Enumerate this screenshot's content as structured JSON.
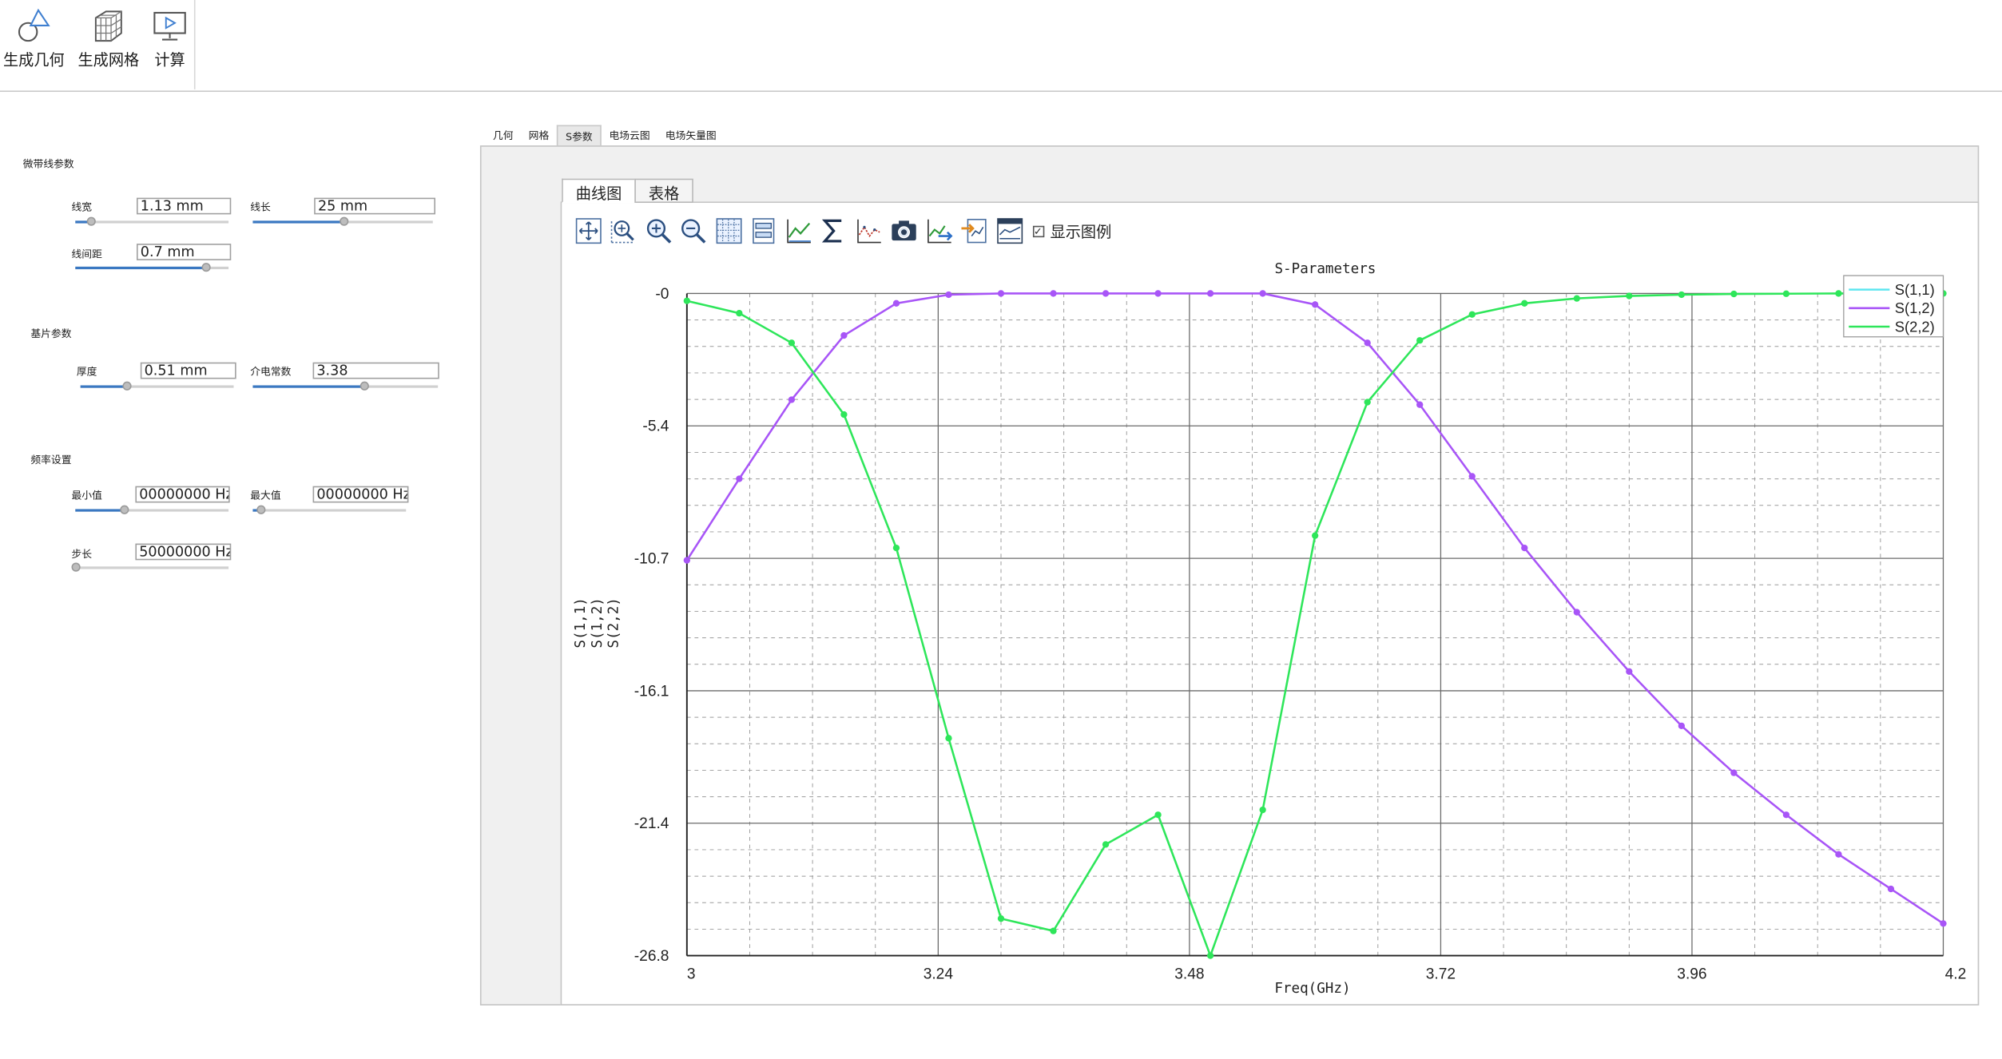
{
  "ribbon": {
    "buttons": [
      {
        "label": "生成几何",
        "icon": "geometry-icon"
      },
      {
        "label": "生成网格",
        "icon": "mesh-icon"
      },
      {
        "label": "计算",
        "icon": "compute-icon"
      }
    ]
  },
  "params": {
    "microstrip": {
      "title": "微带线参数",
      "width": {
        "label": "线宽",
        "value": "1.13 mm",
        "level": 0.1
      },
      "length": {
        "label": "线长",
        "value": "25 mm",
        "level": 0.5
      },
      "spacing": {
        "label": "线间距",
        "value": "0.7 mm",
        "level": 0.85
      }
    },
    "substrate": {
      "title": "基片参数",
      "thickness": {
        "label": "厚度",
        "value": "0.51 mm",
        "level": 0.3
      },
      "permittivity": {
        "label": "介电常数",
        "value": "3.38",
        "level": 0.6
      }
    },
    "frequency": {
      "title": "频率设置",
      "min": {
        "label": "最小值",
        "value": "00000000 Hz",
        "level": 0.32
      },
      "max": {
        "label": "最大值",
        "value": "00000000 Hz",
        "level": 0.05
      },
      "step": {
        "label": "步长",
        "value": "50000000 Hz",
        "level": 0.0
      }
    }
  },
  "tabs": [
    "几何",
    "网格",
    "S参数",
    "电场云图",
    "电场矢量图"
  ],
  "active_tab": 2,
  "subtabs": [
    "曲线图",
    "表格"
  ],
  "toolbar": {
    "icons": [
      "pan-icon",
      "zoom-region-icon",
      "zoom-in-icon",
      "zoom-out-icon",
      "grid-icon",
      "fit-icon",
      "line-chart-icon",
      "sum-icon",
      "scatter-icon",
      "camera-icon",
      "export-chart-icon",
      "import-icon",
      "table-chart-icon"
    ],
    "legend_toggle_label": "显示图例",
    "legend_checked": true
  },
  "colors": {
    "s11": "#5ee6f0",
    "s12": "#a855f7",
    "s22": "#2ee65a",
    "slider_fill": "#3a78c2"
  },
  "chart_data": {
    "type": "line",
    "title": "S-Parameters",
    "xlabel": "Freq(GHz)",
    "ylabel": "S(1,1)\nS(1,2)\nS(2,2)",
    "xlim": [
      3.0,
      4.2
    ],
    "ylim": [
      -26.8,
      0
    ],
    "xticks": [
      "3",
      "3.24",
      "3.48",
      "3.72",
      "3.96",
      "4.2"
    ],
    "yticks": [
      "-0",
      "-5.4",
      "-10.7",
      "-16.1",
      "-21.4",
      "-26.8"
    ],
    "legend_position": "top-right",
    "x": [
      3.0,
      3.05,
      3.1,
      3.15,
      3.2,
      3.25,
      3.3,
      3.35,
      3.4,
      3.45,
      3.5,
      3.55,
      3.6,
      3.65,
      3.7,
      3.75,
      3.8,
      3.85,
      3.9,
      3.95,
      4.0,
      4.05,
      4.1,
      4.15,
      4.2
    ],
    "series": [
      {
        "name": "S(1,1)",
        "values": []
      },
      {
        "name": "S(1,2)",
        "values": [
          -10.8,
          -7.5,
          -4.3,
          -1.7,
          -0.4,
          -0.05,
          0,
          0,
          0,
          0,
          0,
          0,
          -0.45,
          -2.0,
          -4.5,
          -7.4,
          -10.3,
          -12.9,
          -15.3,
          -17.5,
          -19.4,
          -21.1,
          -22.7,
          -24.1,
          -25.5
        ]
      },
      {
        "name": "S(2,2)",
        "values": [
          -0.3,
          -0.8,
          -2.0,
          -4.9,
          -10.3,
          -18.0,
          -25.3,
          -25.8,
          -22.3,
          -21.1,
          -26.8,
          -20.9,
          -9.8,
          -4.4,
          -1.9,
          -0.85,
          -0.4,
          -0.2,
          -0.1,
          -0.05,
          -0.02,
          -0.01,
          0,
          0,
          0
        ]
      }
    ]
  }
}
